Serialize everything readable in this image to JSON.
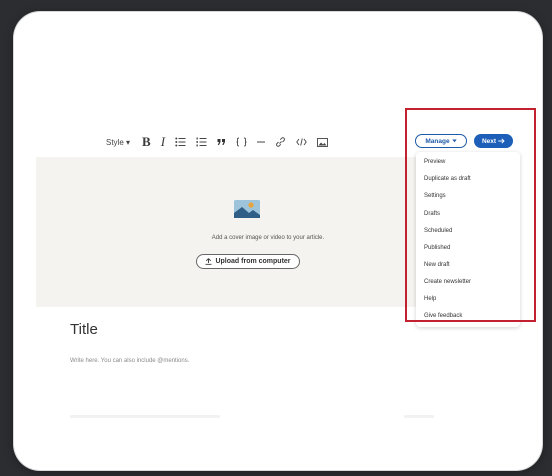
{
  "toolbar": {
    "style_label": "Style ▾",
    "bold_label": "B",
    "italic_label": "I",
    "icons": [
      "bullet-list-icon",
      "numbered-list-icon",
      "quote-icon",
      "code-block-icon",
      "divider-icon",
      "link-icon",
      "embed-code-icon",
      "image-icon"
    ]
  },
  "cover": {
    "prompt": "Add a cover image or video to your article.",
    "upload_label": "Upload from computer"
  },
  "editor": {
    "title_placeholder": "Title",
    "body_placeholder": "Write here. You can also include @mentions."
  },
  "actions": {
    "manage_label": "Manage",
    "next_label": "Next"
  },
  "manage_menu": {
    "items": [
      "Preview",
      "Duplicate as draft",
      "Settings",
      "Drafts",
      "Scheduled",
      "Published",
      "New draft",
      "Create newsletter",
      "Help",
      "Give feedback"
    ]
  },
  "colors": {
    "accent": "#1d5fb8",
    "highlight": "#c3212f"
  }
}
